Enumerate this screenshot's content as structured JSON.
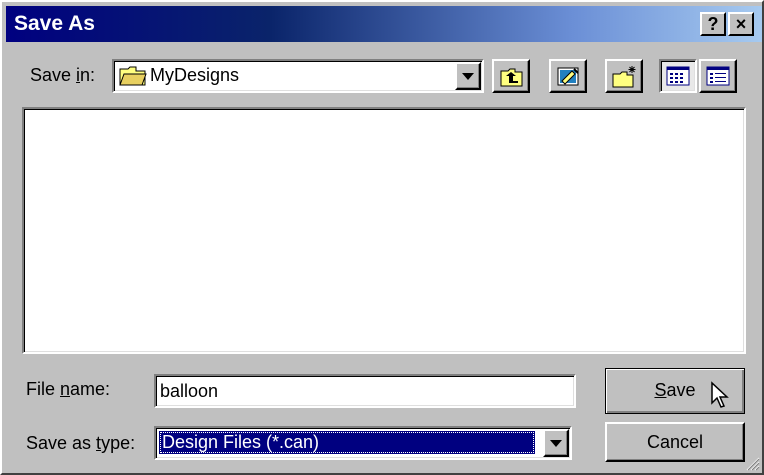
{
  "window": {
    "title": "Save As",
    "help_label": "?",
    "close_label": "×"
  },
  "save_in": {
    "label_prefix": "Save ",
    "label_accel": "i",
    "label_suffix": "n:",
    "value": "MyDesigns",
    "icon": "folder-icon"
  },
  "toolbar": {
    "buttons": [
      {
        "icon": "up-one-level-icon"
      },
      {
        "icon": "go-to-desktop-icon"
      },
      {
        "icon": "create-new-folder-icon"
      },
      {
        "icon": "list-view-icon"
      },
      {
        "icon": "details-view-icon"
      }
    ]
  },
  "file_list": {
    "items": []
  },
  "file_name": {
    "label_prefix": "File ",
    "label_accel": "n",
    "label_suffix": "ame:",
    "value": "balloon"
  },
  "save_as_type": {
    "label_prefix": "Save as ",
    "label_accel": "t",
    "label_suffix": "ype:",
    "value": "Design Files (*.can)"
  },
  "buttons": {
    "save_accel": "S",
    "save_rest": "ave",
    "cancel": "Cancel"
  }
}
